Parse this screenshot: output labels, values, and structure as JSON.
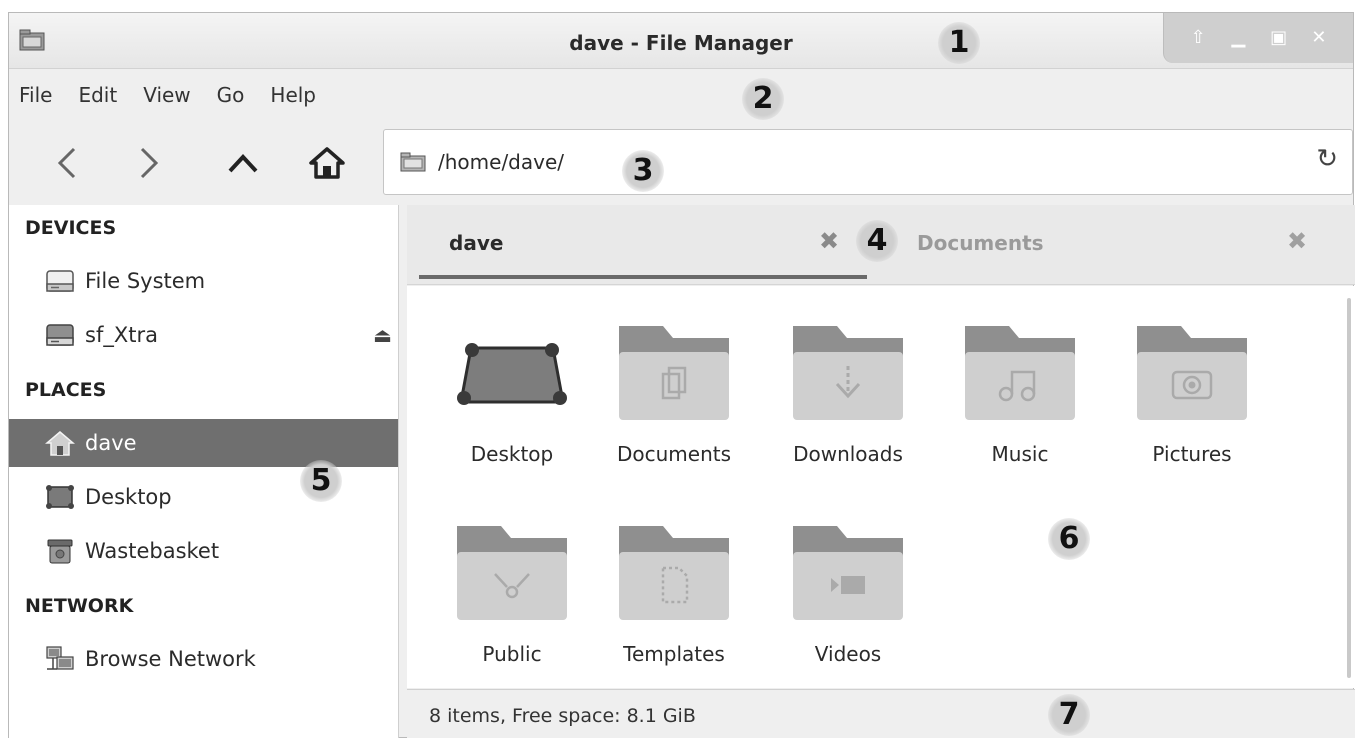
{
  "window": {
    "title": "dave - File Manager"
  },
  "menu": [
    "File",
    "Edit",
    "View",
    "Go",
    "Help"
  ],
  "address": {
    "path": "/home/dave/"
  },
  "sidebar": {
    "devices_header": "DEVICES",
    "devices": [
      {
        "label": "File System",
        "icon": "drive-icon"
      },
      {
        "label": "sf_Xtra",
        "icon": "drive-icon"
      }
    ],
    "places_header": "PLACES",
    "places": [
      {
        "label": "dave",
        "icon": "home-icon",
        "active": true
      },
      {
        "label": "Desktop",
        "icon": "desktop-icon"
      },
      {
        "label": "Wastebasket",
        "icon": "trash-icon"
      }
    ],
    "network_header": "NETWORK",
    "network": [
      {
        "label": "Browse Network",
        "icon": "network-icon"
      }
    ]
  },
  "tabs": [
    {
      "label": "dave",
      "active": true
    },
    {
      "label": "Documents",
      "active": false
    }
  ],
  "files": [
    {
      "name": "Desktop",
      "icon": "desktop-icon"
    },
    {
      "name": "Documents",
      "icon": "folder-documents-icon"
    },
    {
      "name": "Downloads",
      "icon": "folder-downloads-icon"
    },
    {
      "name": "Music",
      "icon": "folder-music-icon"
    },
    {
      "name": "Pictures",
      "icon": "folder-pictures-icon"
    },
    {
      "name": "Public",
      "icon": "folder-public-icon"
    },
    {
      "name": "Templates",
      "icon": "folder-templates-icon"
    },
    {
      "name": "Videos",
      "icon": "folder-videos-icon"
    }
  ],
  "status": {
    "text": "8 items, Free space: 8.1 GiB"
  },
  "callouts": [
    "1",
    "2",
    "3",
    "4",
    "5",
    "6",
    "7"
  ]
}
